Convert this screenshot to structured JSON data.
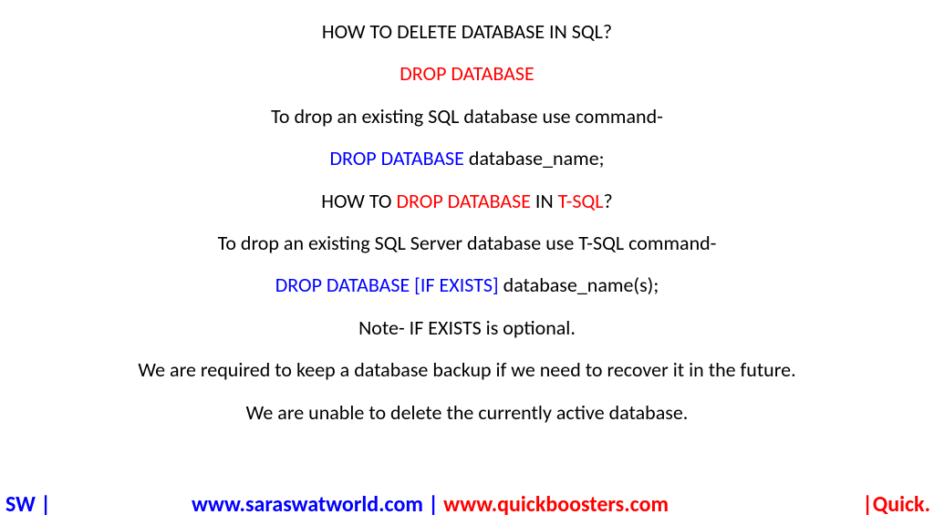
{
  "title": "HOW TO DELETE DATABASE IN SQL?",
  "subtitle": "DROP DATABASE",
  "line1": "To drop an existing SQL database use command-",
  "syntax1_kw": "DROP DATABASE ",
  "syntax1_rest": "database_name;",
  "line3_prefix": "HOW TO ",
  "line3_red1": "DROP DATABASE ",
  "line3_mid": "IN ",
  "line3_red2": "T-SQL",
  "line3_suffix": "?",
  "line4": "To drop an existing SQL Server database use T-SQL command-",
  "syntax2_kw": "DROP DATABASE [IF EXISTS] ",
  "syntax2_rest": "database_name(s);",
  "note": "Note- IF EXISTS is optional.",
  "line7": "We are required to keep a database backup if we need to recover it in the future.",
  "line8": "We are unable to delete the currently active database.",
  "footer": {
    "left": "SW |",
    "url1": "www.saraswatworld.com",
    "sep": " | ",
    "url2": "www.quickboosters.com",
    "right": "|Quick."
  }
}
